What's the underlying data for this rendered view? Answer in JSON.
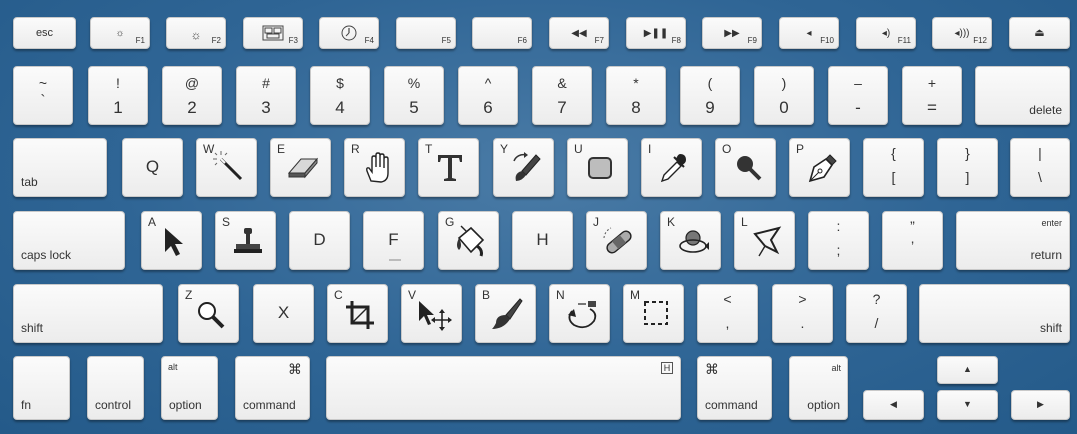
{
  "keyboard": {
    "fn_row": {
      "esc": "esc",
      "f1": "F1",
      "f2": "F2",
      "f3": "F3",
      "f4": "F4",
      "f5": "F5",
      "f6": "F6",
      "f7": "F7",
      "f8": "F8",
      "f9": "F9",
      "f10": "F10",
      "f11": "F11",
      "f12": "F12"
    },
    "number_row": {
      "grave": [
        "~",
        "`"
      ],
      "d1": [
        "!",
        "1"
      ],
      "d2": [
        "@",
        "2"
      ],
      "d3": [
        "#",
        "3"
      ],
      "d4": [
        "$",
        "4"
      ],
      "d5": [
        "%",
        "5"
      ],
      "d6": [
        "^",
        "6"
      ],
      "d7": [
        "&",
        "7"
      ],
      "d8": [
        "*",
        "8"
      ],
      "d9": [
        "(",
        "9"
      ],
      "d0": [
        ")",
        "0"
      ],
      "minus": [
        "–",
        "-"
      ],
      "equal": [
        "+",
        "="
      ],
      "delete": "delete"
    },
    "row_q": {
      "tab": "tab",
      "q": "Q",
      "w": "W",
      "e": "E",
      "r": "R",
      "t": "T",
      "y": "Y",
      "u": "U",
      "i": "I",
      "o": "O",
      "p": "P",
      "lbracket": [
        "{",
        "["
      ],
      "rbracket": [
        "}",
        "]"
      ],
      "backslash": [
        "|",
        "\\"
      ]
    },
    "row_a": {
      "caps": "caps lock",
      "a": "A",
      "s": "S",
      "d": "D",
      "f": "F",
      "g": "G",
      "h": "H",
      "j": "J",
      "k": "K",
      "l": "L",
      "semicolon": [
        ":",
        ";"
      ],
      "quote": [
        "”",
        "’"
      ],
      "enter": "enter",
      "return": "return"
    },
    "row_z": {
      "shift_l": "shift",
      "z": "Z",
      "x": "X",
      "c": "C",
      "v": "V",
      "b": "B",
      "n": "N",
      "m": "M",
      "comma": [
        "<",
        ","
      ],
      "period": [
        ">",
        "."
      ],
      "slash": [
        "?",
        "/"
      ],
      "shift_r": "shift"
    },
    "bottom_row": {
      "fn": "fn",
      "control": "control",
      "alt": "alt",
      "option": "option",
      "command": "command",
      "cmd_symbol": "⌘",
      "space_badge": "H"
    }
  },
  "colors": {
    "background": "#2f6595",
    "key_face": "#f4f4f4",
    "key_text": "#333333",
    "icon_dark": "#222222"
  }
}
